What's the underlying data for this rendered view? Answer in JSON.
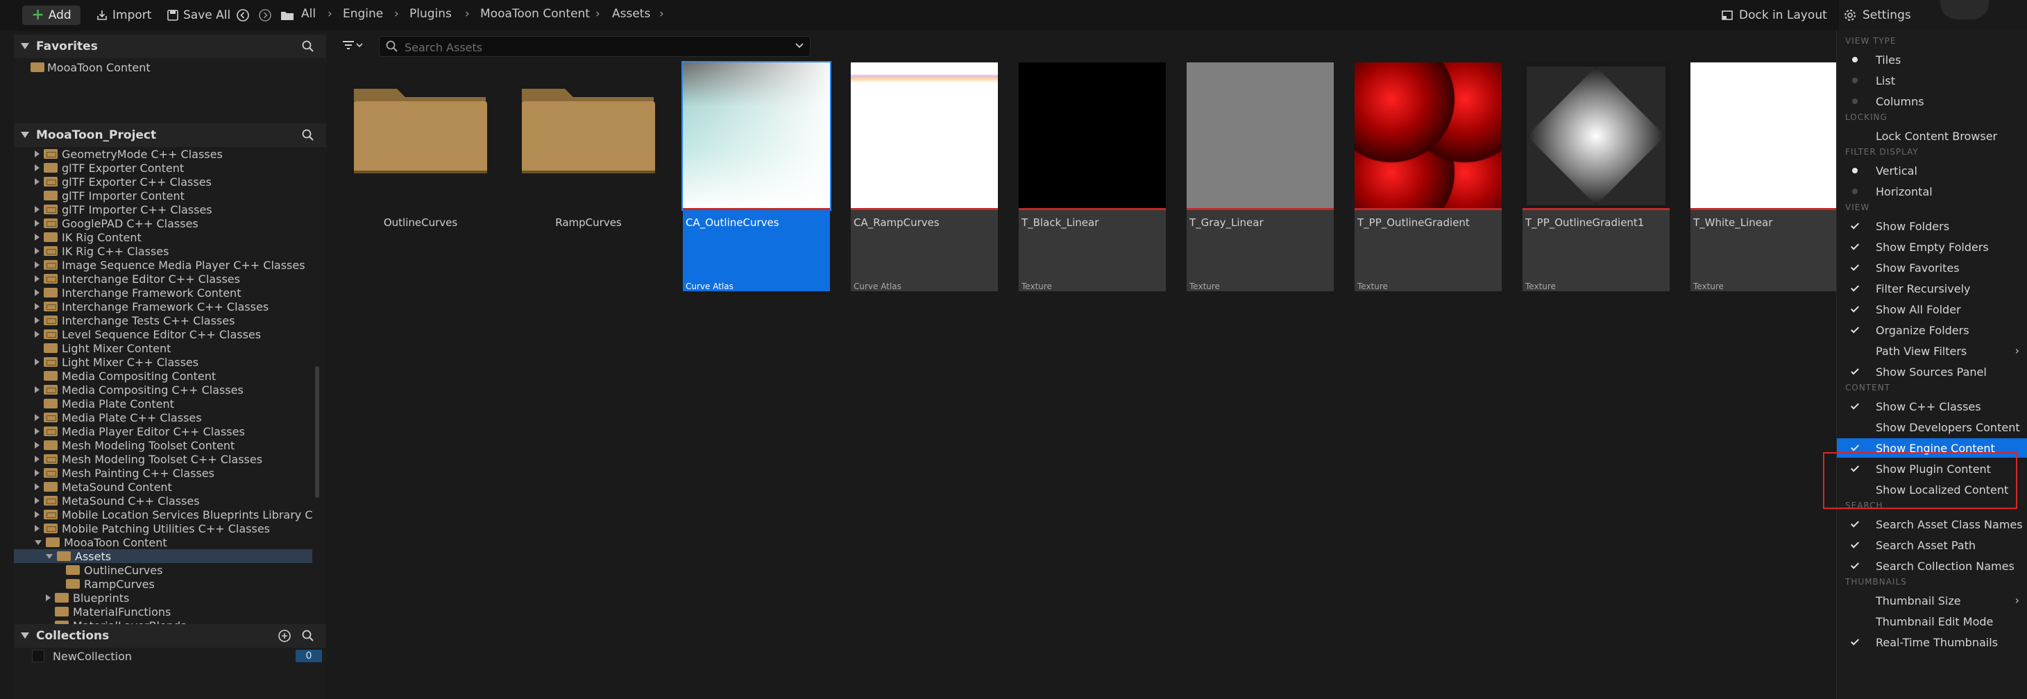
{
  "toolbar": {
    "add_label": "Add",
    "import_label": "Import",
    "save_all_label": "Save All",
    "breadcrumbs": [
      "All",
      "Engine",
      "Plugins",
      "MooaToon Content",
      "Assets"
    ],
    "dock_label": "Dock in Layout",
    "settings_label": "Settings"
  },
  "favorites": {
    "title": "Favorites",
    "items": [
      "MooaToon Content"
    ]
  },
  "project": {
    "title": "MooaToon_Project",
    "tree": [
      {
        "label": "GeometryMode C++ Classes",
        "indent": 1,
        "expand": "closed",
        "cpp": true
      },
      {
        "label": "glTF Exporter Content",
        "indent": 1,
        "expand": "closed",
        "cpp": false
      },
      {
        "label": "glTF Exporter C++ Classes",
        "indent": 1,
        "expand": "closed",
        "cpp": true
      },
      {
        "label": "glTF Importer Content",
        "indent": 1,
        "expand": "none",
        "cpp": false
      },
      {
        "label": "glTF Importer C++ Classes",
        "indent": 1,
        "expand": "closed",
        "cpp": true
      },
      {
        "label": "GooglePAD C++ Classes",
        "indent": 1,
        "expand": "closed",
        "cpp": true
      },
      {
        "label": "IK Rig Content",
        "indent": 1,
        "expand": "closed",
        "cpp": false
      },
      {
        "label": "IK Rig C++ Classes",
        "indent": 1,
        "expand": "closed",
        "cpp": true
      },
      {
        "label": "Image Sequence Media Player C++ Classes",
        "indent": 1,
        "expand": "closed",
        "cpp": true
      },
      {
        "label": "Interchange Editor C++ Classes",
        "indent": 1,
        "expand": "closed",
        "cpp": true
      },
      {
        "label": "Interchange Framework Content",
        "indent": 1,
        "expand": "closed",
        "cpp": false
      },
      {
        "label": "Interchange Framework C++ Classes",
        "indent": 1,
        "expand": "closed",
        "cpp": true
      },
      {
        "label": "Interchange Tests C++ Classes",
        "indent": 1,
        "expand": "closed",
        "cpp": true
      },
      {
        "label": "Level Sequence Editor C++ Classes",
        "indent": 1,
        "expand": "closed",
        "cpp": true
      },
      {
        "label": "Light Mixer Content",
        "indent": 1,
        "expand": "none",
        "cpp": false
      },
      {
        "label": "Light Mixer C++ Classes",
        "indent": 1,
        "expand": "closed",
        "cpp": true
      },
      {
        "label": "Media Compositing Content",
        "indent": 1,
        "expand": "none",
        "cpp": false
      },
      {
        "label": "Media Compositing C++ Classes",
        "indent": 1,
        "expand": "closed",
        "cpp": true
      },
      {
        "label": "Media Plate Content",
        "indent": 1,
        "expand": "none",
        "cpp": false
      },
      {
        "label": "Media Plate C++ Classes",
        "indent": 1,
        "expand": "closed",
        "cpp": true
      },
      {
        "label": "Media Player Editor C++ Classes",
        "indent": 1,
        "expand": "closed",
        "cpp": true
      },
      {
        "label": "Mesh Modeling Toolset Content",
        "indent": 1,
        "expand": "closed",
        "cpp": false
      },
      {
        "label": "Mesh Modeling Toolset C++ Classes",
        "indent": 1,
        "expand": "closed",
        "cpp": true
      },
      {
        "label": "Mesh Painting C++ Classes",
        "indent": 1,
        "expand": "closed",
        "cpp": true
      },
      {
        "label": "MetaSound Content",
        "indent": 1,
        "expand": "closed",
        "cpp": false
      },
      {
        "label": "MetaSound C++ Classes",
        "indent": 1,
        "expand": "closed",
        "cpp": true
      },
      {
        "label": "Mobile Location Services Blueprints Library C",
        "indent": 1,
        "expand": "closed",
        "cpp": true
      },
      {
        "label": "Mobile Patching Utilities C++ Classes",
        "indent": 1,
        "expand": "closed",
        "cpp": true
      },
      {
        "label": "MooaToon Content",
        "indent": 1,
        "expand": "open",
        "cpp": false
      },
      {
        "label": "Assets",
        "indent": 2,
        "expand": "open",
        "cpp": false,
        "selected": true
      },
      {
        "label": "OutlineCurves",
        "indent": 3,
        "expand": "none",
        "cpp": false
      },
      {
        "label": "RampCurves",
        "indent": 3,
        "expand": "none",
        "cpp": false
      },
      {
        "label": "Blueprints",
        "indent": 2,
        "expand": "closed",
        "cpp": false
      },
      {
        "label": "MaterialFunctions",
        "indent": 2,
        "expand": "none",
        "cpp": false
      },
      {
        "label": "MaterialLayerBlends",
        "indent": 2,
        "expand": "none",
        "cpp": false
      }
    ]
  },
  "collections": {
    "title": "Collections",
    "items": [
      {
        "label": "NewCollection",
        "count": "0"
      }
    ]
  },
  "search": {
    "placeholder": "Search Assets"
  },
  "assets": [
    {
      "name": "OutlineCurves",
      "kind": "folder",
      "type": ""
    },
    {
      "name": "RampCurves",
      "kind": "folder",
      "type": ""
    },
    {
      "name": "CA_OutlineCurves",
      "kind": "curve-atlas-outline",
      "type": "Curve Atlas",
      "selected": true
    },
    {
      "name": "CA_RampCurves",
      "kind": "curve-atlas-ramp",
      "type": "Curve Atlas"
    },
    {
      "name": "T_Black_Linear",
      "kind": "black",
      "type": "Texture"
    },
    {
      "name": "T_Gray_Linear",
      "kind": "gray",
      "type": "Texture"
    },
    {
      "name": "T_PP_OutlineGradient",
      "kind": "red-dots",
      "type": "Texture"
    },
    {
      "name": "T_PP_OutlineGradient1",
      "kind": "diamond",
      "type": "Texture"
    },
    {
      "name": "T_White_Linear",
      "kind": "white",
      "type": "Texture"
    }
  ],
  "settings_menu": {
    "sections": [
      {
        "title": "VIEW TYPE",
        "items": [
          {
            "label": "Tiles",
            "kind": "radio",
            "checked": true
          },
          {
            "label": "List",
            "kind": "radio",
            "checked": false
          },
          {
            "label": "Columns",
            "kind": "radio",
            "checked": false
          }
        ]
      },
      {
        "title": "LOCKING",
        "items": [
          {
            "label": "Lock Content Browser",
            "kind": "none"
          }
        ]
      },
      {
        "title": "FILTER DISPLAY",
        "items": [
          {
            "label": "Vertical",
            "kind": "radio",
            "checked": true
          },
          {
            "label": "Horizontal",
            "kind": "radio",
            "checked": false
          }
        ]
      },
      {
        "title": "VIEW",
        "items": [
          {
            "label": "Show Folders",
            "kind": "check",
            "checked": true
          },
          {
            "label": "Show Empty Folders",
            "kind": "check",
            "checked": true
          },
          {
            "label": "Show Favorites",
            "kind": "check",
            "checked": true
          },
          {
            "label": "Filter Recursively",
            "kind": "check",
            "checked": true
          },
          {
            "label": "Show All Folder",
            "kind": "check",
            "checked": true
          },
          {
            "label": "Organize Folders",
            "kind": "check",
            "checked": true
          },
          {
            "label": "Path View Filters",
            "kind": "none",
            "submenu": true
          },
          {
            "label": "Show Sources Panel",
            "kind": "tick",
            "checked": true
          }
        ]
      },
      {
        "title": "CONTENT",
        "items": [
          {
            "label": "Show C++ Classes",
            "kind": "check",
            "checked": true
          },
          {
            "label": "Show Developers Content",
            "kind": "check",
            "checked": false
          },
          {
            "label": "Show Engine Content",
            "kind": "check",
            "checked": true,
            "highlighted": true
          },
          {
            "label": "Show Plugin Content",
            "kind": "check",
            "checked": true
          },
          {
            "label": "Show Localized Content",
            "kind": "check",
            "checked": false
          }
        ]
      },
      {
        "title": "SEARCH",
        "items": [
          {
            "label": "Search Asset Class Names",
            "kind": "check",
            "checked": true
          },
          {
            "label": "Search Asset Path",
            "kind": "check",
            "checked": true
          },
          {
            "label": "Search Collection Names",
            "kind": "check",
            "checked": true
          }
        ]
      },
      {
        "title": "THUMBNAILS",
        "items": [
          {
            "label": "Thumbnail Size",
            "kind": "none",
            "submenu": true
          },
          {
            "label": "Thumbnail Edit Mode",
            "kind": "check",
            "checked": false
          },
          {
            "label": "Real-Time Thumbnails",
            "kind": "check",
            "checked": true
          }
        ]
      }
    ]
  },
  "colors": {
    "selection": "#0e6fe0",
    "annotation_box": "#d62828",
    "folder": "#b08a4e"
  }
}
